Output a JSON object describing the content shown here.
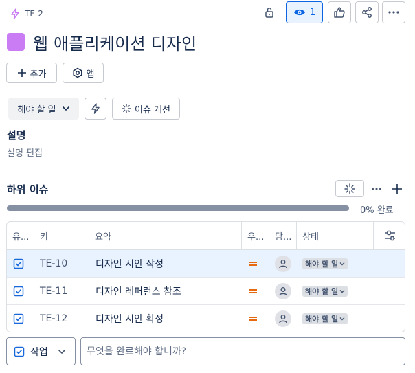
{
  "issue": {
    "key": "TE-2",
    "title": "웹 애플리케이션 디자인",
    "color": "#c97cf4"
  },
  "header": {
    "watch_count": "1"
  },
  "actions": {
    "add_label": "추가",
    "apps_label": "앱"
  },
  "status_bar": {
    "status_label": "해야 할 일",
    "improve_label": "이슈 개선"
  },
  "description": {
    "heading": "설명",
    "placeholder": "설명 편집"
  },
  "subtasks": {
    "heading": "하위 이슈",
    "progress_text": "0% 완료",
    "progress": 0,
    "columns": [
      "유...",
      "키",
      "요약",
      "우...",
      "담...",
      "상태"
    ],
    "rows": [
      {
        "key": "TE-10",
        "summary": "디자인 시안 작성",
        "status": "해야 할 일"
      },
      {
        "key": "TE-11",
        "summary": "디자인 레퍼런스 참조",
        "status": "해야 할 일"
      },
      {
        "key": "TE-12",
        "summary": "디자인 시안 확정",
        "status": "해야 할 일"
      }
    ]
  },
  "create": {
    "type_label": "작업",
    "placeholder": "무엇을 완료해야 합니까?"
  },
  "colors": {
    "accent": "#0c66e4",
    "watch_bg": "#e9f2ff",
    "priority": "#e56910",
    "task_icon": "#1868db"
  }
}
